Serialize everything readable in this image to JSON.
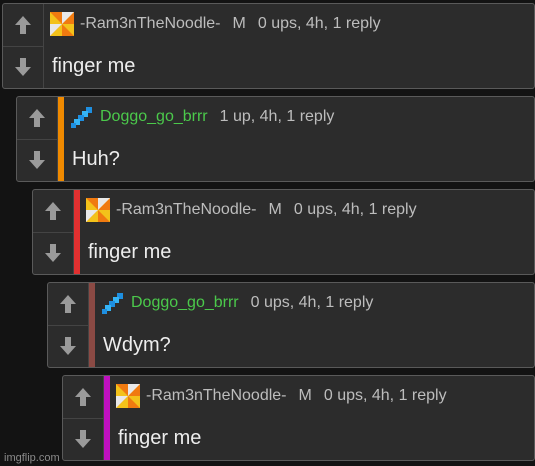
{
  "comments": [
    {
      "username": "-Ram3nTheNoodle-",
      "badge": "M",
      "meta": "0 ups, 4h, 1 reply",
      "text": "finger me",
      "avatar": "pinwheel-avatar",
      "bar_color": "",
      "name_color": "#bdbdbd"
    },
    {
      "username": "Doggo_go_brrr",
      "badge": "",
      "meta": "1 up, 4h, 1 reply",
      "text": "Huh?",
      "avatar": "pixel-diagonal-avatar",
      "bar_color": "#f08a00",
      "name_color": "#4bc94b"
    },
    {
      "username": "-Ram3nTheNoodle-",
      "badge": "M",
      "meta": "0 ups, 4h, 1 reply",
      "text": "finger me",
      "avatar": "pinwheel-avatar",
      "bar_color": "#e23030",
      "name_color": "#bdbdbd"
    },
    {
      "username": "Doggo_go_brrr",
      "badge": "",
      "meta": "0 ups, 4h, 1 reply",
      "text": "Wdym?",
      "avatar": "pixel-diagonal-avatar",
      "bar_color": "#8b4a44",
      "name_color": "#4bc94b"
    },
    {
      "username": "-Ram3nTheNoodle-",
      "badge": "M",
      "meta": "0 ups, 4h, 1 reply",
      "text": "finger me",
      "avatar": "pinwheel-avatar",
      "bar_color": "#c010c0",
      "name_color": "#bdbdbd"
    }
  ],
  "watermark": "imgflip.com"
}
